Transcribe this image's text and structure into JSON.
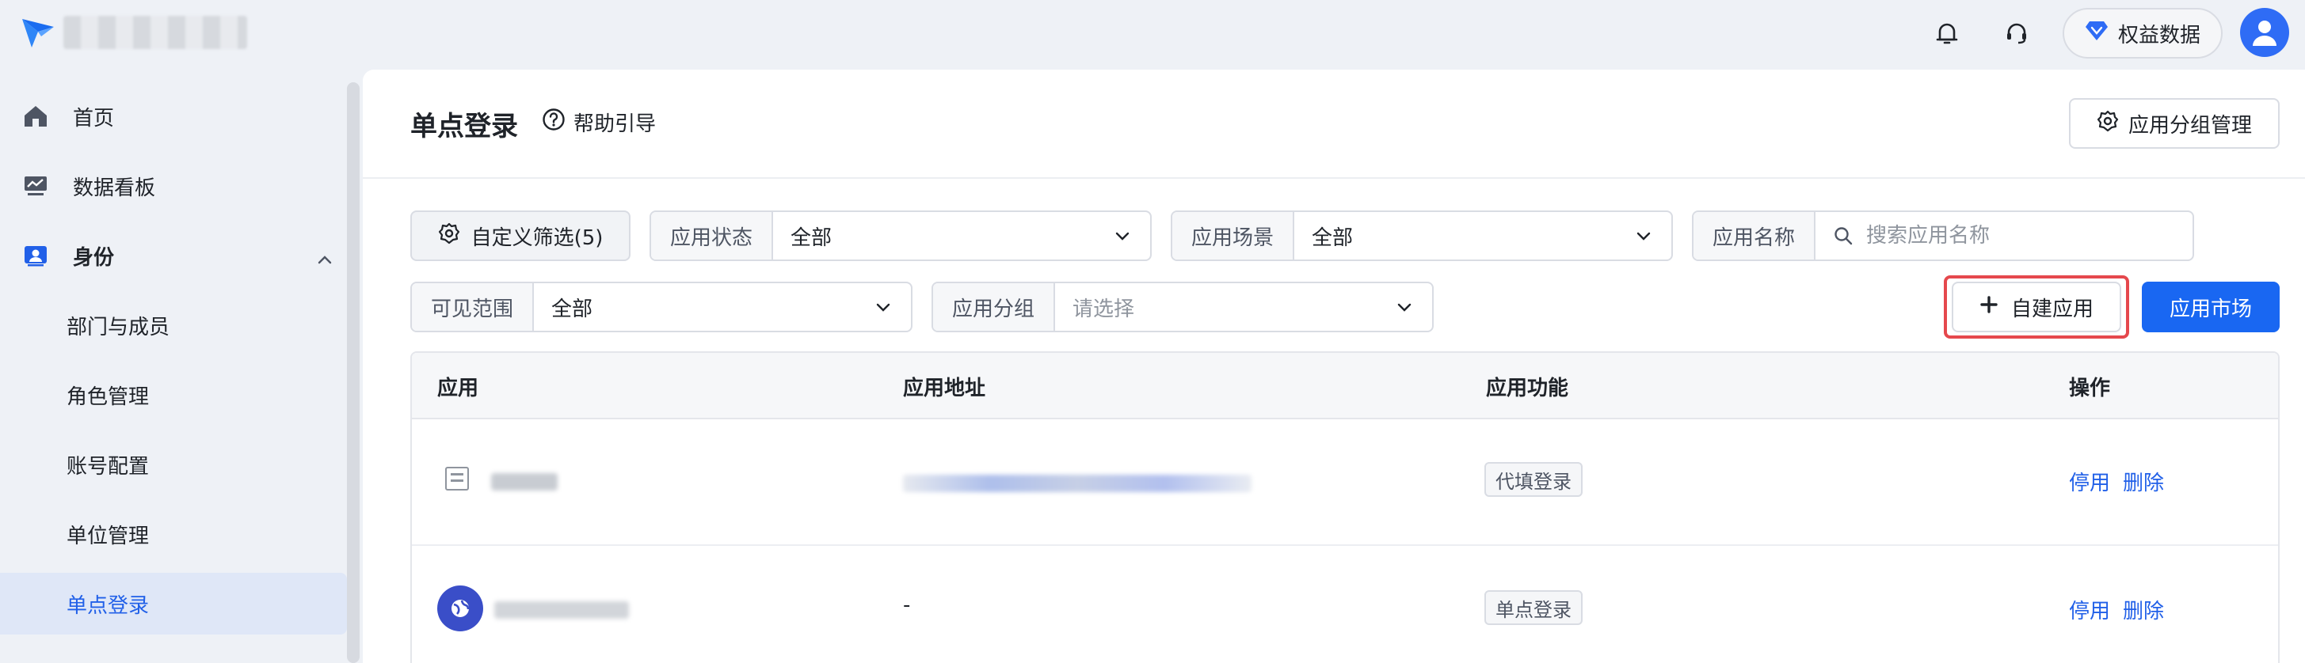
{
  "topbar": {
    "benefit_label": "权益数据"
  },
  "sidebar": {
    "items": [
      {
        "label": "首页",
        "icon": "home-icon"
      },
      {
        "label": "数据看板",
        "icon": "dashboard-icon"
      },
      {
        "label": "身份",
        "icon": "identity-icon"
      },
      {
        "label": "部门与成员"
      },
      {
        "label": "角色管理"
      },
      {
        "label": "账号配置"
      },
      {
        "label": "单位管理"
      },
      {
        "label": "单点登录"
      }
    ]
  },
  "header": {
    "title": "单点登录",
    "help_label": "帮助引导",
    "group_manage_label": "应用分组管理"
  },
  "filters": {
    "custom_filter_label": "自定义筛选(5)",
    "status": {
      "label": "应用状态",
      "value": "全部"
    },
    "scene": {
      "label": "应用场景",
      "value": "全部"
    },
    "name": {
      "label": "应用名称",
      "placeholder": "搜索应用名称"
    },
    "scope": {
      "label": "可见范围",
      "value": "全部"
    },
    "group": {
      "label": "应用分组",
      "placeholder": "请选择"
    }
  },
  "actions": {
    "new_app_label": "自建应用",
    "market_label": "应用市场"
  },
  "table": {
    "columns": [
      "应用",
      "应用地址",
      "应用功能",
      "操作"
    ],
    "rows": [
      {
        "address": "",
        "feature": "代填登录",
        "ops": [
          "停用",
          "删除"
        ]
      },
      {
        "address": "-",
        "feature": "单点登录",
        "ops": [
          "停用",
          "删除"
        ]
      }
    ]
  },
  "colors": {
    "primary": "#1967f2",
    "link": "#2160e8",
    "highlight": "#e5484d",
    "active_bg": "#dfe7f7"
  }
}
